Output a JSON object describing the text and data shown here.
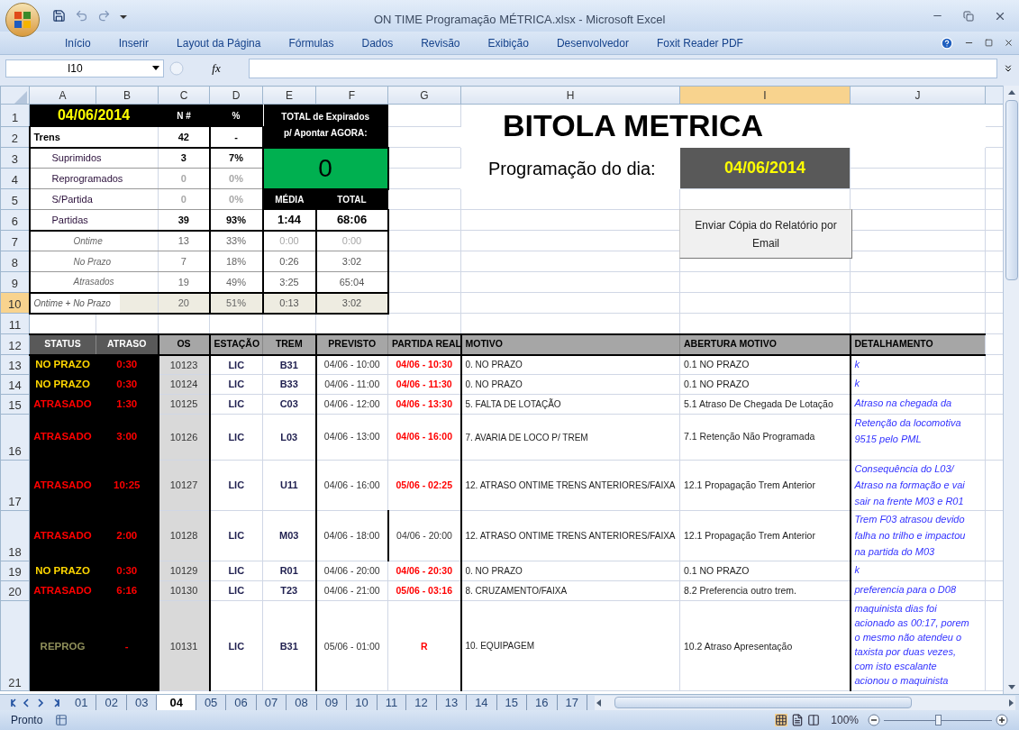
{
  "window": {
    "title": "ON TIME Programação MÉTRICA.xlsx - Microsoft Excel"
  },
  "ribbon_tabs": [
    "Início",
    "Inserir",
    "Layout da Página",
    "Fórmulas",
    "Dados",
    "Revisão",
    "Exibição",
    "Desenvolvedor",
    "Foxit Reader PDF"
  ],
  "formula_bar": {
    "name_box": "I10",
    "fx": "fx"
  },
  "column_headers": [
    {
      "label": "A",
      "selected": false
    },
    {
      "label": "B",
      "selected": false
    },
    {
      "label": "C",
      "selected": false
    },
    {
      "label": "D",
      "selected": false
    },
    {
      "label": "E",
      "selected": false
    },
    {
      "label": "F",
      "selected": false
    },
    {
      "label": "G",
      "selected": false
    },
    {
      "label": "H",
      "selected": false
    },
    {
      "label": "I",
      "selected": true
    },
    {
      "label": "J",
      "selected": false
    }
  ],
  "row_headers": [
    {
      "label": "1",
      "selected": false
    },
    {
      "label": "2",
      "selected": false
    },
    {
      "label": "3",
      "selected": false
    },
    {
      "label": "4",
      "selected": false
    },
    {
      "label": "5",
      "selected": false
    },
    {
      "label": "6",
      "selected": false
    },
    {
      "label": "7",
      "selected": false
    },
    {
      "label": "8",
      "selected": false
    },
    {
      "label": "9",
      "selected": false
    },
    {
      "label": "10",
      "selected": true
    },
    {
      "label": "11",
      "selected": false
    },
    {
      "label": "12",
      "selected": false
    },
    {
      "label": "13",
      "selected": false
    },
    {
      "label": "14",
      "selected": false
    },
    {
      "label": "15",
      "selected": false
    },
    {
      "label": "16",
      "selected": false
    },
    {
      "label": "17",
      "selected": false
    },
    {
      "label": "18",
      "selected": false
    },
    {
      "label": "19",
      "selected": false
    },
    {
      "label": "20",
      "selected": false
    },
    {
      "label": "21",
      "selected": false
    }
  ],
  "summary": {
    "date": "04/06/2014",
    "count_header": "N #",
    "pct_header": "%",
    "expired": {
      "lines": [
        "TOTAL de Expirados",
        "p/ Apontar AGORA:"
      ],
      "value": "0"
    },
    "time_headers": [
      "MÉDIA",
      "TOTAL"
    ],
    "rows": [
      {
        "kind": "total",
        "label": "Trens",
        "count": "42",
        "pct": "-",
        "muted": false
      },
      {
        "kind": "sub",
        "label": "Suprimidos",
        "count": "3",
        "pct": "7%",
        "muted": false
      },
      {
        "kind": "sub",
        "label": "Reprogramados",
        "count": "0",
        "pct": "0%",
        "muted": true
      },
      {
        "kind": "sub",
        "label": "S/Partida",
        "count": "0",
        "pct": "0%",
        "muted": true
      },
      {
        "kind": "sub",
        "label": "Partidas",
        "count": "39",
        "pct": "93%",
        "muted": false,
        "media": "1:44",
        "total": "68:06",
        "times_muted": false
      },
      {
        "kind": "detail",
        "label": "Ontime",
        "count": "13",
        "pct": "33%",
        "muted": false,
        "media": "0:00",
        "total": "0:00",
        "times_muted": true
      },
      {
        "kind": "detail",
        "label": "No Prazo",
        "count": "7",
        "pct": "18%",
        "muted": false,
        "media": "0:26",
        "total": "3:02",
        "times_muted": false
      },
      {
        "kind": "detail",
        "label": "Atrasados",
        "count": "19",
        "pct": "49%",
        "muted": false,
        "media": "3:25",
        "total": "65:04",
        "times_muted": false
      },
      {
        "kind": "combined",
        "label": "Ontime + No Prazo",
        "count": "20",
        "pct": "51%",
        "muted": false,
        "media": "0:13",
        "total": "3:02",
        "times_muted": false
      }
    ]
  },
  "title": "BITOLA METRICA",
  "schedule": {
    "label": "Programação do dia:",
    "date": "04/06/2014"
  },
  "email_button": "Enviar Cópia do Relatório por Email",
  "table": {
    "columns": [
      "STATUS",
      "ATRASO",
      "OS",
      "ESTAÇÃO",
      "TREM",
      "PREVISTO",
      "PARTIDA REAL",
      "MOTIVO",
      "ABERTURA MOTIVO",
      "DETALHAMENTO"
    ],
    "rows": [
      {
        "status": "NO PRAZO",
        "kind": "no_prazo",
        "atraso": "0:30",
        "os": "10123",
        "estacao": "LIC",
        "trem": "B31",
        "previsto": "04/06 - 10:00",
        "partida_real": "04/06 - 10:30",
        "late": true,
        "motivo": "0. NO PRAZO",
        "abertura": "0.1 NO PRAZO",
        "detail": [
          "k"
        ]
      },
      {
        "status": "NO PRAZO",
        "kind": "no_prazo",
        "atraso": "0:30",
        "os": "10124",
        "estacao": "LIC",
        "trem": "B33",
        "previsto": "04/06 - 11:00",
        "partida_real": "04/06 - 11:30",
        "late": true,
        "motivo": "0. NO PRAZO",
        "abertura": "0.1 NO PRAZO",
        "detail": [
          "k"
        ]
      },
      {
        "status": "ATRASADO",
        "kind": "atrasado",
        "atraso": "1:30",
        "os": "10125",
        "estacao": "LIC",
        "trem": "C03",
        "previsto": "04/06 - 12:00",
        "partida_real": "04/06 - 13:30",
        "late": true,
        "motivo": "5. FALTA DE LOTAÇÃO",
        "abertura": "5.1 Atraso De Chegada De Lotação",
        "detail": [
          "Atraso na chegada da"
        ]
      },
      {
        "status": "ATRASADO",
        "kind": "atrasado",
        "atraso": "3:00",
        "os": "10126",
        "estacao": "LIC",
        "trem": "L03",
        "previsto": "04/06 - 13:00",
        "partida_real": "04/06 - 16:00",
        "late": true,
        "motivo": "7. AVARIA DE LOCO P/ TREM",
        "abertura": "7.1 Retenção Não Programada",
        "detail": [
          "Retenção da locomotiva",
          "9515 pelo PML"
        ]
      },
      {
        "status": "ATRASADO",
        "kind": "atrasado",
        "atraso": "10:25",
        "os": "10127",
        "estacao": "LIC",
        "trem": "U11",
        "previsto": "04/06 - 16:00",
        "partida_real": "05/06 - 02:25",
        "late": true,
        "motivo": "12. ATRASO ONTIME TRENS ANTERIORES/FAIXA",
        "abertura": "12.1 Propagação Trem Anterior",
        "detail": [
          "Consequência do L03/",
          "Atraso na formação e vai",
          "sair na frente M03 e R01"
        ]
      },
      {
        "status": "ATRASADO",
        "kind": "atrasado",
        "atraso": "2:00",
        "os": "10128",
        "estacao": "LIC",
        "trem": "M03",
        "previsto": "04/06 - 18:00",
        "partida_real": "04/06 - 20:00",
        "late": false,
        "motivo": "12. ATRASO ONTIME TRENS ANTERIORES/FAIXA",
        "abertura": "12.1 Propagação Trem Anterior",
        "detail": [
          "Trem F03 atrasou devido",
          "falha no trilho e impactou",
          "na partida do M03"
        ]
      },
      {
        "status": "NO PRAZO",
        "kind": "no_prazo",
        "atraso": "0:30",
        "os": "10129",
        "estacao": "LIC",
        "trem": "R01",
        "previsto": "04/06 - 20:00",
        "partida_real": "04/06 - 20:30",
        "late": true,
        "motivo": "0. NO PRAZO",
        "abertura": "0.1 NO PRAZO",
        "detail": [
          "k"
        ]
      },
      {
        "status": "ATRASADO",
        "kind": "atrasado",
        "atraso": "6:16",
        "os": "10130",
        "estacao": "LIC",
        "trem": "T23",
        "previsto": "04/06 - 21:00",
        "partida_real": "05/06 - 03:16",
        "late": true,
        "motivo": "8. CRUZAMENTO/FAIXA",
        "abertura": "8.2 Preferencia outro trem.",
        "detail": [
          "preferencia para o D08"
        ]
      },
      {
        "status": "REPROG",
        "kind": "reprog",
        "atraso": "-",
        "os": "10131",
        "estacao": "LIC",
        "trem": "B31",
        "previsto": "05/06 - 01:00",
        "partida_real": "R",
        "late": true,
        "motivo": "10. EQUIPAGEM",
        "abertura": "10.2 Atraso Apresentação",
        "detail": [
          "maquinista dias foi",
          "acionado as 00:17, porem",
          "o mesmo não atendeu o",
          "taxista por duas vezes,",
          "com isto escalante",
          "acionou o maquinista"
        ]
      }
    ]
  },
  "sheet_tabs": [
    {
      "label": "01",
      "selected": false
    },
    {
      "label": "02",
      "selected": false
    },
    {
      "label": "03",
      "selected": false
    },
    {
      "label": "04",
      "selected": true
    },
    {
      "label": "05",
      "selected": false
    },
    {
      "label": "06",
      "selected": false
    },
    {
      "label": "07",
      "selected": false
    },
    {
      "label": "08",
      "selected": false
    },
    {
      "label": "09",
      "selected": false
    },
    {
      "label": "10",
      "selected": false
    },
    {
      "label": "11",
      "selected": false
    },
    {
      "label": "12",
      "selected": false
    },
    {
      "label": "13",
      "selected": false
    },
    {
      "label": "14",
      "selected": false
    },
    {
      "label": "15",
      "selected": false
    },
    {
      "label": "16",
      "selected": false
    },
    {
      "label": "17",
      "selected": false
    }
  ],
  "status_bar": {
    "text": "Pronto",
    "zoom": "100%",
    "zoom_slider": {
      "level": 0.5
    }
  }
}
